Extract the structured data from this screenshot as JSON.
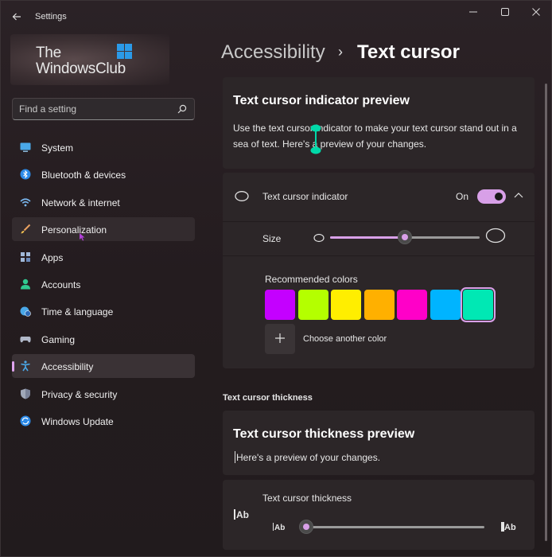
{
  "window": {
    "title": "Settings",
    "back_icon": "arrow-left-icon",
    "minimize": "—",
    "maximize": "☐",
    "close": "✕"
  },
  "logo": {
    "line1": "The",
    "line2": "WindowsClub"
  },
  "search": {
    "placeholder": "Find a setting",
    "icon": "search-icon"
  },
  "sidebar": {
    "items": [
      {
        "label": "System",
        "icon": "monitor-icon",
        "color": "#4aa8e8"
      },
      {
        "label": "Bluetooth & devices",
        "icon": "bluetooth-icon",
        "color": "#2b8ae8"
      },
      {
        "label": "Network & internet",
        "icon": "wifi-icon",
        "color": "#7ab8f0"
      },
      {
        "label": "Personalization",
        "icon": "brush-icon",
        "color": "#e8a060"
      },
      {
        "label": "Apps",
        "icon": "apps-icon",
        "color": "#a0b8d8"
      },
      {
        "label": "Accounts",
        "icon": "person-icon",
        "color": "#30c890"
      },
      {
        "label": "Time & language",
        "icon": "globe-clock-icon",
        "color": "#4aa8e8"
      },
      {
        "label": "Gaming",
        "icon": "gamepad-icon",
        "color": "#b0b8c8"
      },
      {
        "label": "Accessibility",
        "icon": "accessibility-icon",
        "color": "#4aa8e8"
      },
      {
        "label": "Privacy & security",
        "icon": "shield-icon",
        "color": "#a0a8b8"
      },
      {
        "label": "Windows Update",
        "icon": "update-icon",
        "color": "#2b8ae8"
      }
    ]
  },
  "breadcrumb": {
    "parent": "Accessibility",
    "separator": "›",
    "current": "Text cursor"
  },
  "indicator_preview": {
    "title": "Text cursor indicator preview",
    "description_line1": "Use the text cursor indicator to make your text cursor stand out in a",
    "description_line2": "sea of text. Here's a preview of your changes."
  },
  "indicator_setting": {
    "label": "Text cursor indicator",
    "state": "On",
    "size_label": "Size",
    "size_fraction": 0.5,
    "recommended_label": "Recommended colors",
    "colors": [
      "#c400ff",
      "#b4ff00",
      "#ffee00",
      "#ffb000",
      "#ff00c8",
      "#00b4ff",
      "#00e8b4"
    ],
    "selected_color_index": 6,
    "choose_color_label": "Choose another color",
    "accent": "#d8a0e8"
  },
  "thickness_section": {
    "heading": "Text cursor thickness",
    "preview_title": "Text cursor thickness preview",
    "preview_text": "Here's a preview of your changes.",
    "setting_label": "Text cursor thickness",
    "icon_small": "Ab",
    "icon_large": "Ab",
    "thickness_fraction": 0.0
  }
}
